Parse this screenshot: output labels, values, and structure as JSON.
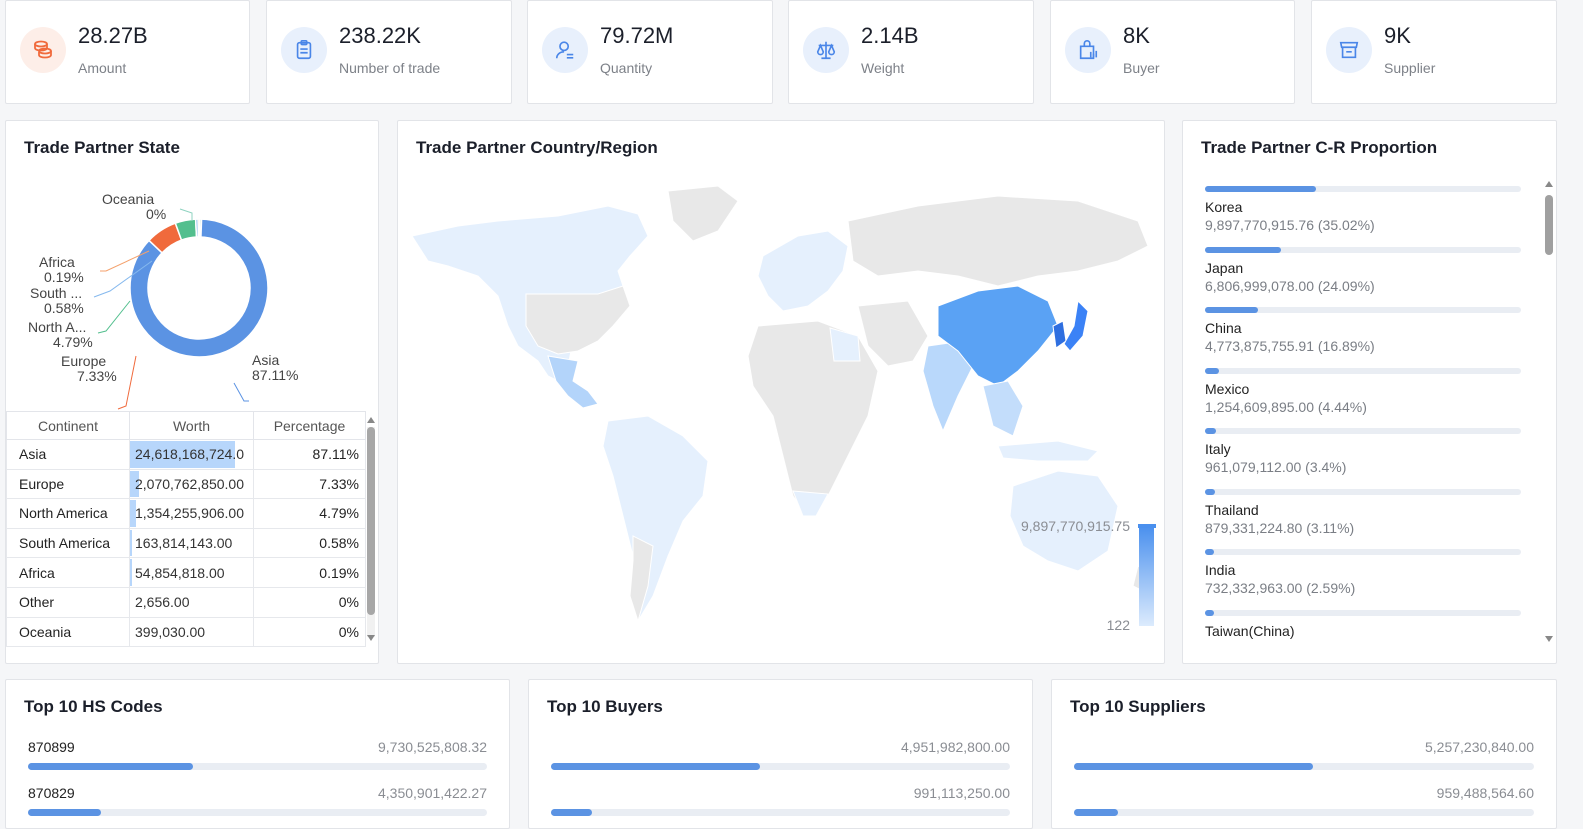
{
  "stats": [
    {
      "value": "28.27B",
      "label": "Amount",
      "icon": "coins-icon",
      "bg": "#fdeee8",
      "color": "#f06a3c"
    },
    {
      "value": "238.22K",
      "label": "Number of trade",
      "icon": "clipboard-icon",
      "bg": "#e8f0fc",
      "color": "#4a86e8"
    },
    {
      "value": "79.72M",
      "label": "Quantity",
      "icon": "user-icon",
      "bg": "#e8f0fc",
      "color": "#4a86e8"
    },
    {
      "value": "2.14B",
      "label": "Weight",
      "icon": "scale-icon",
      "bg": "#e8f0fc",
      "color": "#4a86e8"
    },
    {
      "value": "8K",
      "label": "Buyer",
      "icon": "shopping-bag-icon",
      "bg": "#e8f0fc",
      "color": "#4a86e8"
    },
    {
      "value": "9K",
      "label": "Supplier",
      "icon": "store-icon",
      "bg": "#e8f0fc",
      "color": "#4a86e8"
    }
  ],
  "state_panel": {
    "title": "Trade Partner State",
    "donut_labels": [
      {
        "name": "Oceania",
        "pct": "0%"
      },
      {
        "name": "Africa",
        "pct": "0.19%"
      },
      {
        "name": "South ...",
        "pct": "0.58%"
      },
      {
        "name": "North A...",
        "pct": "4.79%"
      },
      {
        "name": "Europe",
        "pct": "7.33%"
      },
      {
        "name": "Asia",
        "pct": "87.11%"
      }
    ],
    "table_headers": [
      "Continent",
      "Worth",
      "Percentage"
    ],
    "rows": [
      {
        "continent": "Asia",
        "worth": "24,618,168,724.0",
        "pct": "87.11%",
        "share": 0.8711
      },
      {
        "continent": "Europe",
        "worth": "2,070,762,850.00",
        "pct": "7.33%",
        "share": 0.0733
      },
      {
        "continent": "North America",
        "worth": "1,354,255,906.00",
        "pct": "4.79%",
        "share": 0.0479
      },
      {
        "continent": "South America",
        "worth": "163,814,143.00",
        "pct": "0.58%",
        "share": 0.0058
      },
      {
        "continent": "Africa",
        "worth": "54,854,818.00",
        "pct": "0.19%",
        "share": 0.0019
      },
      {
        "continent": "Other",
        "worth": "2,656.00",
        "pct": "0%",
        "share": 0
      },
      {
        "continent": "Oceania",
        "worth": "399,030.00",
        "pct": "0%",
        "share": 0
      }
    ]
  },
  "chart_data": {
    "type": "pie",
    "categories": [
      "Asia",
      "Europe",
      "North America",
      "South America",
      "Africa",
      "Oceania"
    ],
    "values": [
      87.11,
      7.33,
      4.79,
      0.58,
      0.19,
      0.01
    ],
    "colors": [
      "#5b93e3",
      "#f06a3c",
      "#53bf8e",
      "#86b9ee",
      "#f4a16c",
      "#8fd3c0"
    ]
  },
  "map_panel": {
    "title": "Trade Partner Country/Region",
    "scale_max": "9,897,770,915.75",
    "scale_min": "122"
  },
  "proportion_panel": {
    "title": "Trade Partner C-R Proportion",
    "items": [
      {
        "name": "Korea",
        "value": "9,897,770,915.76 (35.02%)",
        "share": 0.3502
      },
      {
        "name": "Japan",
        "value": "6,806,999,078.00 (24.09%)",
        "share": 0.2409
      },
      {
        "name": "China",
        "value": "4,773,875,755.91 (16.89%)",
        "share": 0.1689
      },
      {
        "name": "Mexico",
        "value": "1,254,609,895.00 (4.44%)",
        "share": 0.0444
      },
      {
        "name": "Italy",
        "value": "961,079,112.00 (3.4%)",
        "share": 0.034
      },
      {
        "name": "Thailand",
        "value": "879,331,224.80 (3.11%)",
        "share": 0.0311
      },
      {
        "name": "India",
        "value": "732,332,963.00 (2.59%)",
        "share": 0.0259
      },
      {
        "name": "Taiwan(China)",
        "value": "",
        "share": 0.02
      }
    ]
  },
  "hs_panel": {
    "title": "Top 10 HS Codes",
    "rows": [
      {
        "label": "870899",
        "value": "9,730,525,808.32",
        "share": 0.36
      },
      {
        "label": "870829",
        "value": "4,350,901,422.27",
        "share": 0.16
      }
    ]
  },
  "buyers_panel": {
    "title": "Top 10 Buyers",
    "rows": [
      {
        "label": "",
        "value": "4,951,982,800.00",
        "share": 0.455
      },
      {
        "label": "",
        "value": "991,113,250.00",
        "share": 0.09
      }
    ]
  },
  "suppliers_panel": {
    "title": "Top 10 Suppliers",
    "rows": [
      {
        "label": "",
        "value": "5,257,230,840.00",
        "share": 0.52
      },
      {
        "label": "",
        "value": "959,488,564.60",
        "share": 0.095
      }
    ]
  }
}
